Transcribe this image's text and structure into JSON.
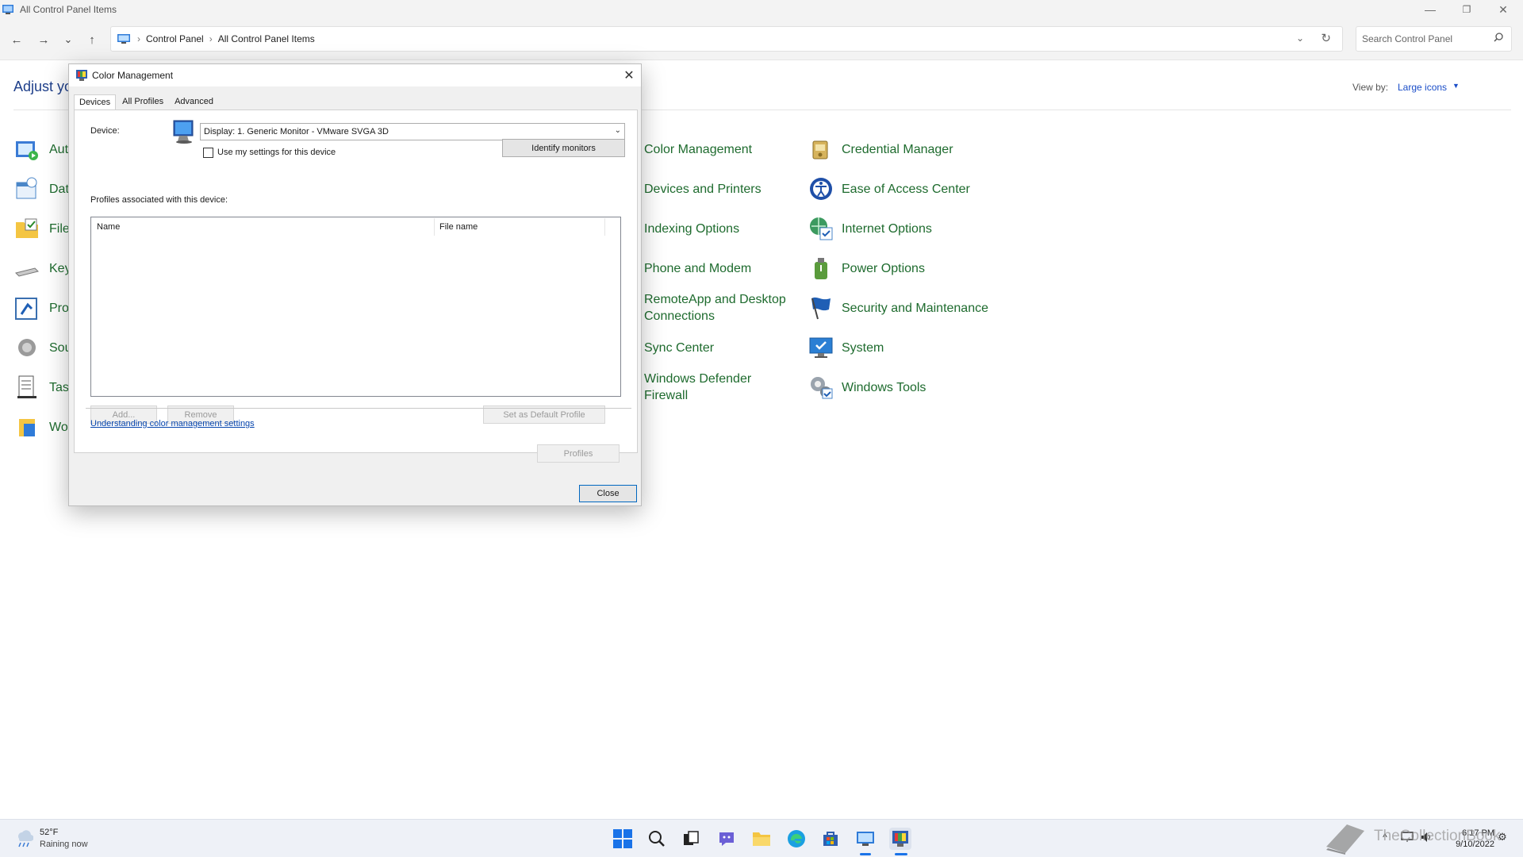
{
  "window": {
    "title": "All Control Panel Items",
    "controls": {
      "minimize": "—",
      "restore": "❐",
      "close": "✕"
    }
  },
  "navbar": {
    "back": "←",
    "forward": "→",
    "recent": "⌄",
    "up": "↑",
    "breadcrumb": [
      "Control Panel",
      "All Control Panel Items"
    ],
    "breadcrumb_sep": "›",
    "search_placeholder": "Search Control Panel"
  },
  "header": {
    "heading_partial": "Adjust you",
    "view_by_label": "View by:",
    "view_by_value": "Large icons"
  },
  "left_items_partial": [
    "Aut",
    "Dat",
    "File",
    "Key",
    "Pro",
    "Sou",
    "Tasl",
    "Wo"
  ],
  "items_col1": [
    {
      "label": "Color Management"
    },
    {
      "label": "Devices and Printers"
    },
    {
      "label": "Indexing Options"
    },
    {
      "label": "Phone and Modem"
    },
    {
      "label": "RemoteApp and Desktop Connections"
    },
    {
      "label": "Sync Center"
    },
    {
      "label": "Windows Defender Firewall"
    }
  ],
  "items_col2": [
    {
      "label": "Credential Manager",
      "icon": "credential-manager-icon"
    },
    {
      "label": "Ease of Access Center",
      "icon": "ease-of-access-icon"
    },
    {
      "label": "Internet Options",
      "icon": "internet-options-icon"
    },
    {
      "label": "Power Options",
      "icon": "power-options-icon"
    },
    {
      "label": "Security and Maintenance",
      "icon": "security-flag-icon"
    },
    {
      "label": "System",
      "icon": "system-monitor-icon"
    },
    {
      "label": "Windows Tools",
      "icon": "windows-tools-icon"
    }
  ],
  "dialog": {
    "title": "Color Management",
    "close": "✕",
    "tabs": [
      "Devices",
      "All Profiles",
      "Advanced"
    ],
    "device_label": "Device:",
    "device_value": "Display: 1. Generic Monitor - VMware SVGA 3D",
    "use_my_settings": "Use my settings for this device",
    "use_my_settings_checked": false,
    "identify_monitors": "Identify monitors",
    "profiles_label": "Profiles associated with this device:",
    "columns": [
      "Name",
      "File name"
    ],
    "rows": [],
    "add": "Add...",
    "remove": "Remove",
    "set_default": "Set as Default Profile",
    "link": "Understanding color management settings",
    "profiles_button": "Profiles",
    "close_button": "Close"
  },
  "taskbar": {
    "weather_temp": "52°F",
    "weather_desc": "Raining now",
    "time": "6:17 PM",
    "date": "9/10/2022",
    "watermark_text": "TheCollectionBook",
    "accent": "#1a73e8"
  }
}
